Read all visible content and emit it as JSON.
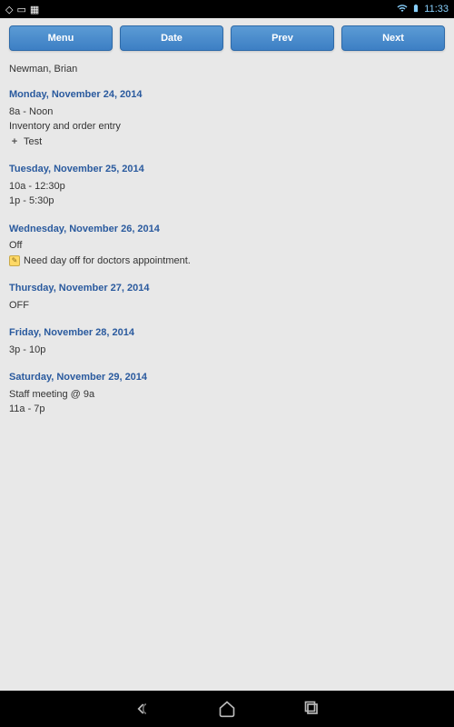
{
  "status_bar": {
    "time": "11:33",
    "wifi_icon": "▾",
    "battery_icon": "▮"
  },
  "toolbar": {
    "menu_label": "Menu",
    "date_label": "Date",
    "prev_label": "Prev",
    "next_label": "Next"
  },
  "user": {
    "name": "Newman, Brian"
  },
  "schedule": {
    "day0": {
      "header": "Monday, November 24, 2014",
      "line1": "8a - Noon",
      "line2": "Inventory and order entry",
      "line3": "Test"
    },
    "day1": {
      "header": "Tuesday, November 25, 2014",
      "line1": "10a - 12:30p",
      "line2": "1p - 5:30p"
    },
    "day2": {
      "header": "Wednesday, November 26, 2014",
      "line1": "Off",
      "line2": "Need day off for doctors appointment."
    },
    "day3": {
      "header": "Thursday, November 27, 2014",
      "line1": "OFF"
    },
    "day4": {
      "header": "Friday, November 28, 2014",
      "line1": "3p - 10p"
    },
    "day5": {
      "header": "Saturday, November 29, 2014",
      "line1": "Staff meeting @ 9a",
      "line2": "11a - 7p"
    }
  }
}
